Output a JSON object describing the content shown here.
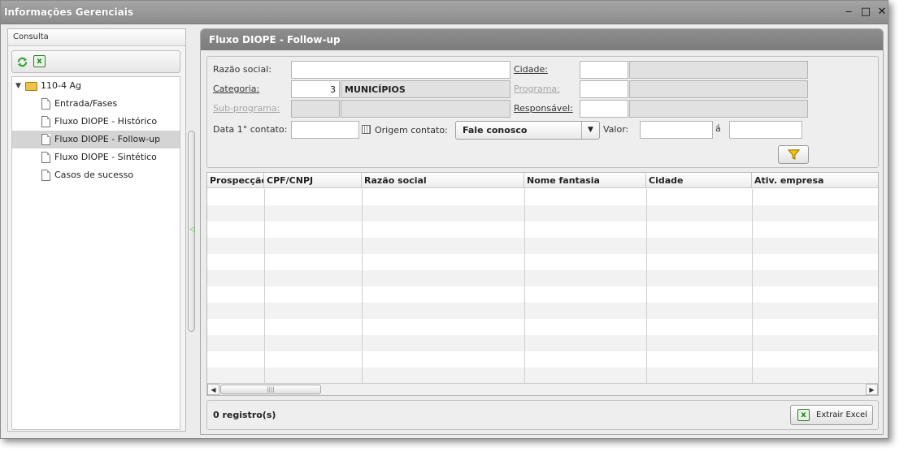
{
  "window": {
    "title": "Informações Gerenciais",
    "controls": {
      "minimize": "‒",
      "maximize": "□",
      "close": "✕"
    }
  },
  "left_panel": {
    "header": "Consulta",
    "tree": {
      "root_label": "110-4 Ag",
      "items": [
        {
          "label": "Entrada/Fases",
          "selected": false
        },
        {
          "label": "Fluxo DIOPE - Histórico",
          "selected": false
        },
        {
          "label": "Fluxo DIOPE - Follow-up",
          "selected": true
        },
        {
          "label": "Fluxo DIOPE - Sintético",
          "selected": false
        },
        {
          "label": "Casos de sucesso",
          "selected": false
        }
      ]
    }
  },
  "right_panel": {
    "title": "Fluxo DIOPE - Follow-up",
    "filters": {
      "razao_social": {
        "label": "Razão social:",
        "value": ""
      },
      "cidade": {
        "label": "Cidade:",
        "code": "",
        "name": ""
      },
      "categoria": {
        "label": "Categoria:",
        "code": "3",
        "name": "MUNICÍPIOS"
      },
      "programa": {
        "label": "Programa:",
        "code": "",
        "name": ""
      },
      "sub_programa": {
        "label": "Sub-programa:",
        "code": "",
        "name": ""
      },
      "responsavel": {
        "label": "Responsável:",
        "code": "",
        "name": ""
      },
      "data_contato": {
        "label": "Data 1° contato:",
        "value": ""
      },
      "origem_contato": {
        "label": "Origem contato:",
        "value": "Fale conosco"
      },
      "valor": {
        "label": "Valor:",
        "from": "",
        "to_label": "á",
        "to": ""
      }
    },
    "grid": {
      "columns": [
        "Prospecção",
        "CPF/CNPJ",
        "Razão social",
        "Nome fantasia",
        "Cidade",
        "Ativ. empresa"
      ],
      "scroll_left": "◀",
      "scroll_right": "▶",
      "thumb_grip": "||||"
    },
    "footer": {
      "count": "0 registro(s)",
      "excel_button": "Extrair Excel"
    }
  },
  "colors": {
    "title_bar": "#999999",
    "panel_header": "#858585",
    "selected_row": "#d4d4d4",
    "filter_icon": "#f5c400",
    "excel_green": "#237a23",
    "refresh_green": "#3aa33a"
  },
  "icons": {
    "refresh": "refresh-icon",
    "excel": "excel-icon",
    "filter": "filter-icon",
    "calendar": "calendar-icon",
    "folder": "folder-open-icon",
    "document": "document-icon"
  }
}
